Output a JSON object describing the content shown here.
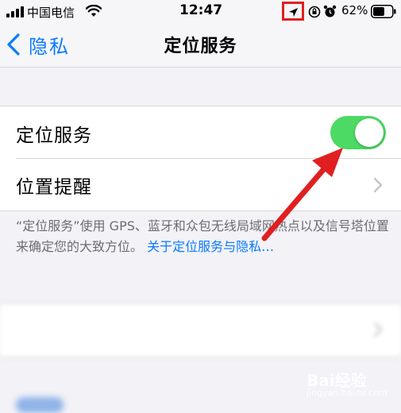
{
  "status_bar": {
    "carrier": "中国电信",
    "time": "12:47",
    "battery_percent": "62%",
    "battery_level": 0.62,
    "icons": [
      "signal-icon",
      "wifi-icon",
      "location-arrow-icon",
      "orientation-lock-icon",
      "alarm-icon",
      "battery-icon"
    ]
  },
  "nav": {
    "back_label": "隐私",
    "title": "定位服务"
  },
  "settings": {
    "rows": [
      {
        "label": "定位服务",
        "control": "toggle",
        "on": true
      },
      {
        "label": "位置提醒",
        "control": "chevron"
      }
    ],
    "footer_text": "“定位服务”使用 GPS、蓝牙和众包无线局域网热点以及信号塔位置来确定您的大致方位。",
    "footer_link": "关于定位服务与隐私…"
  },
  "colors": {
    "accent": "#0a7aff",
    "toggle_on": "#4cd964",
    "annotation": "#e02020"
  },
  "watermark": {
    "brand": "Bai经验",
    "domain": "jingyan.baidu.com"
  }
}
